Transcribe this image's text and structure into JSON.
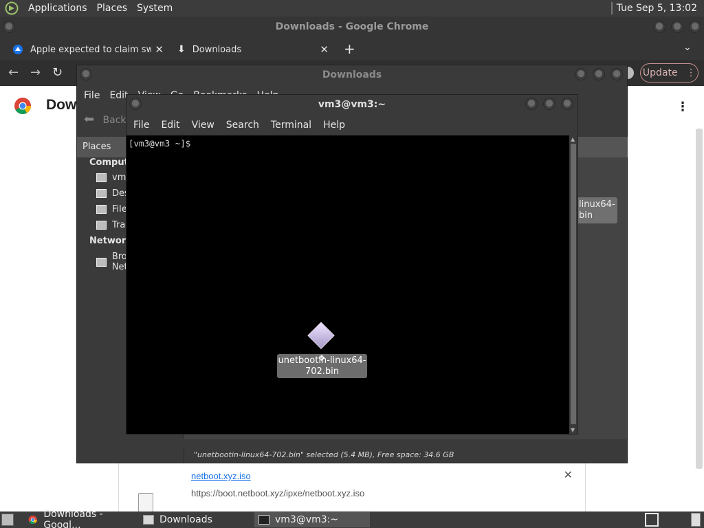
{
  "top_panel": {
    "menus": [
      "Applications",
      "Places",
      "System"
    ],
    "clock": "Tue Sep  5, 13:02"
  },
  "chrome": {
    "window_title": "Downloads - Google Chrome",
    "tabs": [
      {
        "label": "Apple expected to claim switch",
        "icon": "news-icon"
      },
      {
        "label": "Downloads",
        "icon": "download-icon"
      }
    ],
    "new_tab": "+",
    "update_label": "Update",
    "page_heading": "Downloads",
    "download_item": {
      "name": "netboot.xyz.iso",
      "url": "https://boot.netboot.xyz/ipxe/netboot.xyz.iso"
    }
  },
  "caja": {
    "window_title": "Downloads",
    "menus": [
      "File",
      "Edit",
      "View",
      "Go",
      "Bookmarks",
      "Help"
    ],
    "back_label": "Back",
    "places_label": "Places",
    "sidebar": {
      "computer_heading": "Computer",
      "computer_items": [
        "vm3",
        "Desktop",
        "File System",
        "Trash"
      ],
      "network_heading": "Network",
      "network_items": [
        "Browse Network"
      ]
    },
    "background_file_label": "linux64-\nbin",
    "status": "\"unetbootin-linux64-702.bin\" selected (5.4 MB), Free space: 34.6 GB"
  },
  "terminal": {
    "window_title": "vm3@vm3:~",
    "menus": [
      "File",
      "Edit",
      "View",
      "Search",
      "Terminal",
      "Help"
    ],
    "prompt": "[vm3@vm3 ~]$ "
  },
  "drag_item": {
    "label": "unetbootin-linux64-702.bin"
  },
  "taskbar": {
    "tasks": [
      "Downloads - Googl...",
      "Downloads",
      "vm3@vm3:~"
    ]
  }
}
